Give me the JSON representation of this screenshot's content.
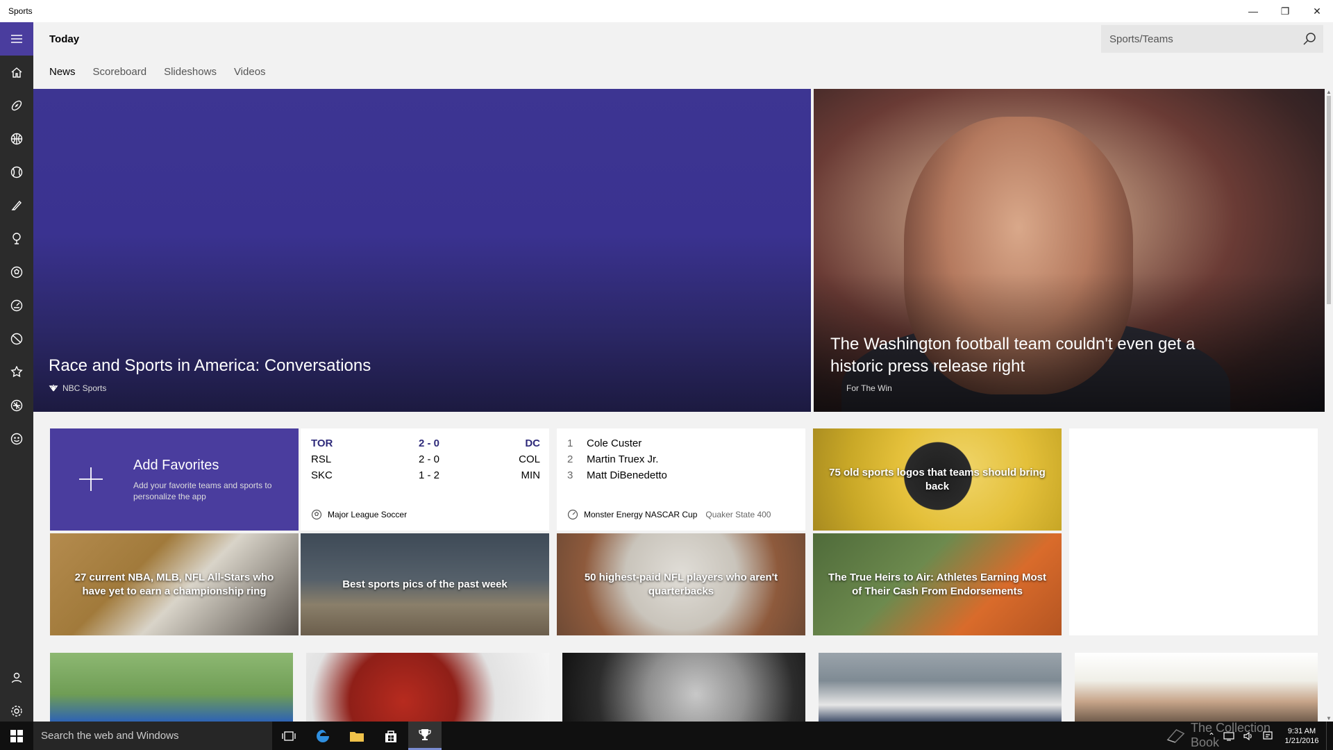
{
  "app": {
    "title": "Sports"
  },
  "window_controls": {
    "minimize": "—",
    "maximize": "❐",
    "close": "✕"
  },
  "header": {
    "title": "Today",
    "search": {
      "placeholder": "Sports/Teams",
      "value": ""
    },
    "tabs": [
      {
        "label": "News",
        "active": true
      },
      {
        "label": "Scoreboard",
        "active": false
      },
      {
        "label": "Slideshows",
        "active": false
      },
      {
        "label": "Videos",
        "active": false
      }
    ]
  },
  "rail": {
    "items": [
      "hamburger-icon",
      "home-icon",
      "football-icon",
      "basketball-icon",
      "baseball-icon",
      "hockey-icon",
      "golf-icon",
      "soccer-icon",
      "racing-icon",
      "tennis-icon",
      "rankings-icon",
      "rugby-icon",
      "fantasy-icon",
      "account-icon",
      "settings-icon"
    ]
  },
  "hero": {
    "left": {
      "headline": "Race and Sports in America: Conversations",
      "source": "NBC Sports"
    },
    "right": {
      "headline": "The Washington football team couldn't even get a historic press release right",
      "source": "For The Win"
    }
  },
  "favorites": {
    "title": "Add Favorites",
    "subtitle": "Add your favorite teams and sports to personalize the app"
  },
  "scores": {
    "league": "Major League Soccer",
    "rows": [
      {
        "team1": "TOR",
        "score": "2 - 0",
        "team2": "DC",
        "lead": true
      },
      {
        "team1": "RSL",
        "score": "2 - 0",
        "team2": "COL",
        "lead": false
      },
      {
        "team1": "SKC",
        "score": "1 - 2",
        "team2": "MIN",
        "lead": false
      }
    ]
  },
  "race": {
    "series": "Monster Energy NASCAR Cup",
    "event": "Quaker State 400",
    "rows": [
      {
        "rank": "1",
        "name": "Cole Custer"
      },
      {
        "rank": "2",
        "name": "Martin Truex Jr."
      },
      {
        "rank": "3",
        "name": "Matt DiBenedetto"
      }
    ]
  },
  "tiles": {
    "logos": "75 old sports logos that teams should bring back",
    "allstars": "27 current NBA, MLB, NFL All-Stars who have yet to earn a championship ring",
    "pics": "Best sports pics of the past week",
    "nfl": "50 highest-paid NFL players who aren't quarterbacks",
    "heirs": "The True Heirs to Air: Athletes Earning Most of Their Cash From Endorsements"
  },
  "taskbar": {
    "search_text": "Search the web and Windows",
    "time": "9:31 AM",
    "date": "1/21/2016",
    "watermark": "The Collection Book"
  },
  "colors": {
    "accent": "#4a3d9e",
    "rail": "#2b2b2b",
    "score_lead": "#2e2a7a"
  }
}
